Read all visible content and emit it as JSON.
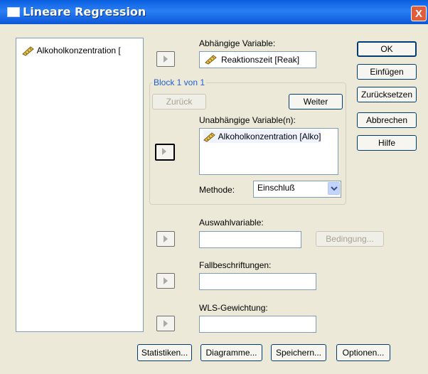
{
  "window": {
    "title": "Lineare Regression",
    "close_label": "X"
  },
  "source_list": {
    "items": [
      {
        "label": "Alkoholkonzentration ["
      }
    ]
  },
  "dependent": {
    "label": "Abhängige Variable:",
    "value": "Reaktionszeit [Reak]"
  },
  "block": {
    "legend": "Block 1 von 1",
    "back_label": "Zurück",
    "next_label": "Weiter",
    "independent_label": "Unabhängige Variable(n):",
    "independent_items": [
      {
        "label": "Alkoholkonzentration [Alko]"
      }
    ],
    "method_label": "Methode:",
    "method_value": "Einschluß"
  },
  "selection": {
    "label": "Auswahlvariable:",
    "value": "",
    "condition_label": "Bedingung..."
  },
  "case_labels": {
    "label": "Fallbeschriftungen:",
    "value": ""
  },
  "wls": {
    "label": "WLS-Gewichtung:",
    "value": ""
  },
  "side_buttons": {
    "ok": "OK",
    "paste": "Einfügen",
    "reset": "Zurücksetzen",
    "cancel": "Abbrechen",
    "help": "Hilfe"
  },
  "bottom_buttons": {
    "statistics": "Statistiken...",
    "plots": "Diagramme...",
    "save": "Speichern...",
    "options": "Optionen..."
  },
  "colors": {
    "titlebar": "#0a5fe0",
    "dialog": "#ece9d8",
    "group_legend": "#1f5fd1",
    "close": "#e25b3a"
  }
}
